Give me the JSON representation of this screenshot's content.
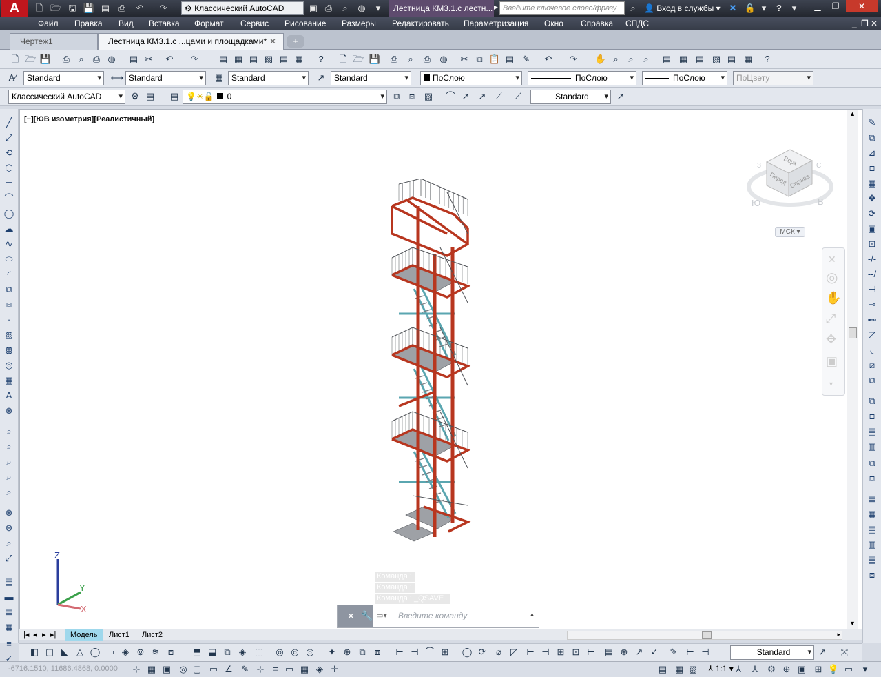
{
  "titlebar": {
    "logo": "A",
    "workspace": "Классический AutoCAD",
    "document_title": "Лестница КМ3.1.с лестн...",
    "search_placeholder": "Введите ключевое слово/фразу",
    "signin": "Вход в службы",
    "help": "?"
  },
  "menu": [
    "Файл",
    "Правка",
    "Вид",
    "Вставка",
    "Формат",
    "Сервис",
    "Рисование",
    "Размеры",
    "Редактировать",
    "Параметризация",
    "Окно",
    "Справка",
    "СПДС"
  ],
  "file_tabs": [
    {
      "label": "Чертеж1"
    },
    {
      "label": "Лестница КМ3.1.с ...цами и площадками*"
    }
  ],
  "styles_toolbar": {
    "text_style": "Standard",
    "dim_style": "Standard",
    "table_style": "Standard",
    "mleader_style": "Standard",
    "color": "ПоСлою",
    "linetype": "ПоСлою",
    "lineweight": "ПоСлою",
    "plotstyle": "ПоЦвету"
  },
  "layers_toolbar": {
    "workspace": "Классический AutoCAD",
    "layer": "0",
    "visual_style": "Standard"
  },
  "viewport": {
    "label": "[−][ЮВ изометрия][Реалистичный]",
    "ucs_x": "X",
    "ucs_y": "Y",
    "ucs_z": "Z"
  },
  "viewcube": {
    "top": "Верх",
    "front": "Перед",
    "right": "Справа",
    "south": "Ю",
    "east": "В",
    "west": "З",
    "north": "С",
    "ucs_menu": "МСК"
  },
  "command": {
    "history": [
      "Команда :",
      "Команда :",
      "Команда :  _QSAVE"
    ],
    "placeholder": "Введите команду"
  },
  "layout_tabs": [
    "Модель",
    "Лист1",
    "Лист2"
  ],
  "model_toolbar": {
    "visual_style": "Standard"
  },
  "status": {
    "coords": "-6716.1510, 11686.4868, 0.0000",
    "scale": "1:1"
  },
  "colors": {
    "steel_red": "#b8361f",
    "stair_teal": "#5aa6b0",
    "grating_gray": "#8a8d92"
  }
}
